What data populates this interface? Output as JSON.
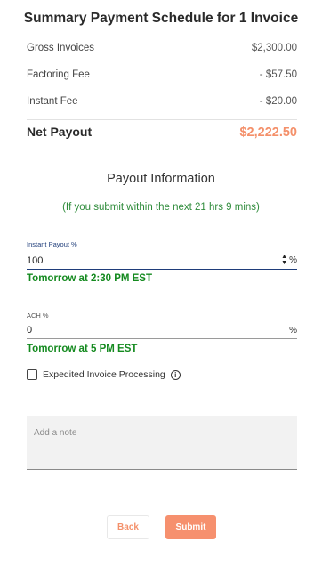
{
  "header": {
    "title": "Summary Payment Schedule for 1 Invoice"
  },
  "summary": {
    "rows": [
      {
        "label": "Gross Invoices",
        "value": "$2,300.00"
      },
      {
        "label": "Factoring Fee",
        "value": "- $57.50"
      },
      {
        "label": "Instant Fee",
        "value": "- $20.00"
      }
    ],
    "net_label": "Net Payout",
    "net_value": "$2,222.50"
  },
  "payout": {
    "title": "Payout Information",
    "window_note": "(If you submit within the next 21 hrs 9 mins)",
    "instant": {
      "label": "Instant Payout %",
      "value": "100",
      "suffix": "%",
      "eta": "Tomorrow at 2:30 PM EST"
    },
    "ach": {
      "label": "ACH %",
      "value": "0",
      "suffix": "%",
      "eta": "Tomorrow at 5 PM EST"
    },
    "expedited_label": "Expedited Invoice Processing",
    "note_placeholder": "Add a note"
  },
  "actions": {
    "back_label": "Back",
    "submit_label": "Submit"
  },
  "colors": {
    "accent": "#f4906a",
    "green": "#148a1f",
    "input_focus": "#1f3d7a"
  }
}
